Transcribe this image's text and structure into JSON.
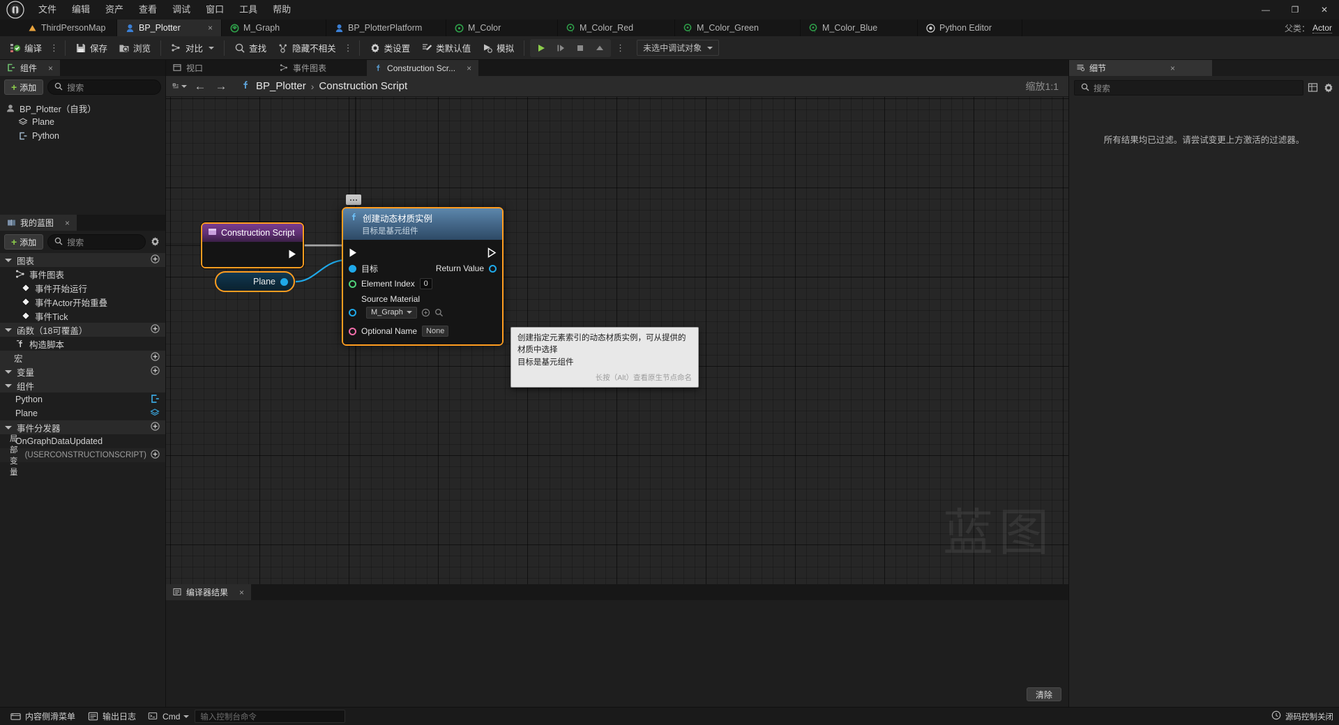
{
  "window": {
    "minimize": "—",
    "maximize": "❐",
    "close": "✕"
  },
  "menu": {
    "items": [
      {
        "label": "文件"
      },
      {
        "label": "编辑"
      },
      {
        "label": "资产"
      },
      {
        "label": "查看"
      },
      {
        "label": "调试"
      },
      {
        "label": "窗口"
      },
      {
        "label": "工具"
      },
      {
        "label": "帮助"
      }
    ]
  },
  "asset_tabs": {
    "items": [
      {
        "label": "ThirdPersonMap",
        "icon": "map-icon",
        "active": false,
        "closable": false
      },
      {
        "label": "BP_Plotter",
        "icon": "blueprint-icon",
        "active": true,
        "closable": true
      },
      {
        "label": "M_Graph",
        "icon": "material-icon",
        "active": false,
        "closable": false
      },
      {
        "label": "BP_PlotterPlatform",
        "icon": "blueprint-icon",
        "active": false,
        "closable": false
      },
      {
        "label": "M_Color",
        "icon": "material-icon",
        "active": false,
        "closable": false
      },
      {
        "label": "M_Color_Red",
        "icon": "material-instance-icon",
        "active": false,
        "closable": false
      },
      {
        "label": "M_Color_Green",
        "icon": "material-instance-icon",
        "active": false,
        "closable": false
      },
      {
        "label": "M_Color_Blue",
        "icon": "material-instance-icon",
        "active": false,
        "closable": false
      },
      {
        "label": "Python Editor",
        "icon": "python-editor-icon",
        "active": false,
        "closable": false
      }
    ],
    "close_glyph": "×",
    "parent_label": "父类：",
    "parent_value": "Actor"
  },
  "toolbar": {
    "compile": "编译",
    "save": "保存",
    "browse": "浏览",
    "diff": "对比",
    "find": "查找",
    "hide_unrelated": "隐藏不相关",
    "class_settings": "类设置",
    "class_defaults": "类默认值",
    "simulate": "模拟",
    "overflow_glyph": "⋮",
    "debug_object": "未选中调试对象"
  },
  "components_panel": {
    "tab_label": "组件",
    "close_glyph": "×",
    "add_label": "添加",
    "search_placeholder": "搜索",
    "tree": [
      {
        "label": "BP_Plotter（自我）",
        "icon": "actor-icon",
        "indent": 0
      },
      {
        "label": "Plane",
        "icon": "static-mesh-icon",
        "indent": 1
      },
      {
        "label": "Python",
        "icon": "component-icon",
        "indent": 1
      }
    ]
  },
  "myblueprint_panel": {
    "tab_label": "我的蓝图",
    "close_glyph": "×",
    "add_label": "添加",
    "search_placeholder": "搜索",
    "sections": [
      {
        "label": "图表",
        "has_add": true,
        "items": [
          {
            "label": "事件图表",
            "icon": "event-graph-icon",
            "indent": 1
          },
          {
            "label": "事件开始运行",
            "icon": "event-node-icon",
            "indent": 2
          },
          {
            "label": "事件Actor开始重叠",
            "icon": "event-node-icon",
            "indent": 2
          },
          {
            "label": "事件Tick",
            "icon": "event-node-icon",
            "indent": 2
          }
        ]
      },
      {
        "label": "函数（18可覆盖）",
        "has_add": true,
        "items": [
          {
            "label": "构造脚本",
            "icon": "function-icon",
            "indent": 1
          }
        ]
      },
      {
        "label": "宏",
        "has_add": true,
        "collapsed": true,
        "items": []
      },
      {
        "label": "变量",
        "has_add": true,
        "items": []
      },
      {
        "label": "组件",
        "has_add": false,
        "items": [
          {
            "label": "Python",
            "icon": "component-icon",
            "indent": 1,
            "right_icons": [
              "component-var-icon"
            ]
          },
          {
            "label": "Plane",
            "icon": "static-mesh-icon",
            "indent": 1,
            "right_icons": [
              "mesh-var-icon"
            ]
          }
        ]
      },
      {
        "label": "事件分发器",
        "has_add": true,
        "items": [
          {
            "label": "OnGraphDataUpdated",
            "icon": "dispatcher-icon",
            "indent": 1
          }
        ]
      }
    ],
    "local_vars": "局部变量",
    "local_vars_scope": "(USERCONSTRUCTIONSCRIPT)"
  },
  "graph": {
    "tabs": [
      {
        "label": "视口",
        "icon": "viewport-icon",
        "active": false,
        "closable": false
      },
      {
        "label": "事件图表",
        "icon": "event-graph-icon",
        "active": false,
        "closable": false
      },
      {
        "label": "Construction Scr...",
        "icon": "function-icon",
        "active": true,
        "closable": true
      }
    ],
    "close_glyph": "×",
    "back_glyph": "←",
    "forward_glyph": "→",
    "breadcrumb_root": "BP_Plotter",
    "breadcrumb_sep": "›",
    "breadcrumb_leaf": "Construction Script",
    "zoom_label": "缩放1:1",
    "watermark": "蓝图",
    "nodes": {
      "construction_script": {
        "title": "Construction Script",
        "icon": "construction-script-icon"
      },
      "plane_ref": {
        "title": "Plane"
      },
      "create_dynamic_material": {
        "title": "创建动态材质实例",
        "subtitle": "目标是基元组件",
        "icon": "function-icon",
        "pins": {
          "target": "目标",
          "return_value": "Return Value",
          "element_index": "Element Index",
          "element_index_value": "0",
          "source_material": "Source Material",
          "source_material_value": "M_Graph",
          "optional_name": "Optional Name",
          "optional_name_value": "None"
        }
      }
    },
    "tooltip": {
      "line1": "创建指定元素索引的动态材质实例，可从提供的材质中选择",
      "line2": "目标是基元组件",
      "hint": "长按（Alt）查看原生节点命名"
    }
  },
  "compiler_panel": {
    "tab_label": "编译器结果",
    "close_glyph": "×",
    "clear_label": "清除"
  },
  "details_panel": {
    "tab_label": "细节",
    "close_glyph": "×",
    "search_placeholder": "搜索",
    "empty_message": "所有结果均已过滤。请尝试变更上方激活的过滤器。"
  },
  "statusbar": {
    "content_drawer": "内容侧滑菜单",
    "output_log": "输出日志",
    "cmd_label": "Cmd",
    "cmd_placeholder": "输入控制台命令",
    "right_text": "源码控制关闭"
  },
  "colors": {
    "accent_orange": "#ff9d20",
    "exec_white": "#ffffff",
    "object_blue": "#1fa8e8",
    "int_green": "#4fd17a",
    "name_pink": "#f06ea9",
    "play_green": "#8ccc4b"
  }
}
